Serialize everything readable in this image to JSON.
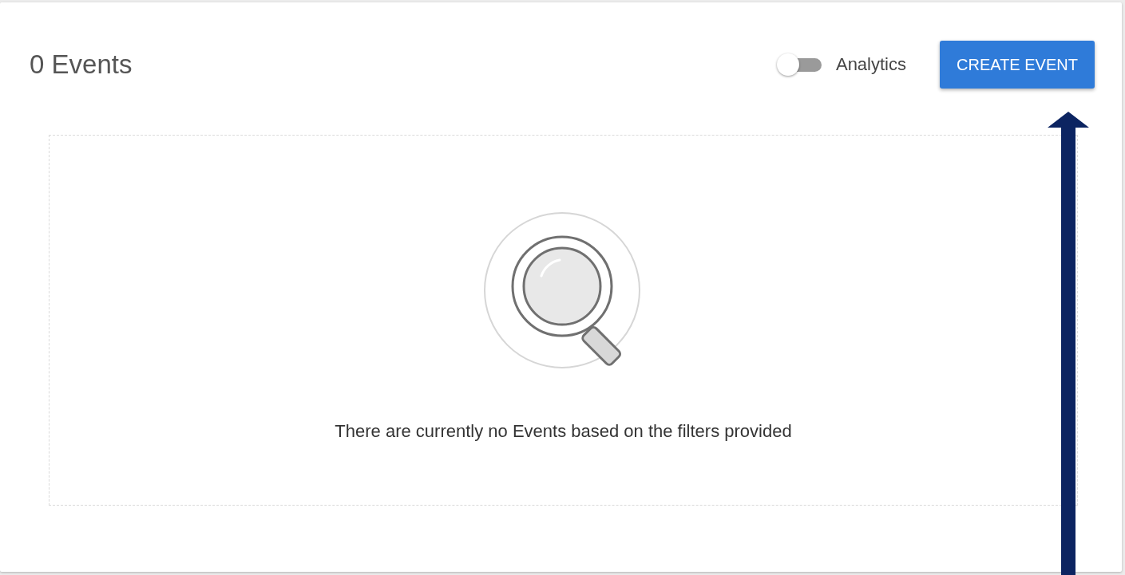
{
  "header": {
    "title": "0 Events",
    "analytics_toggle": {
      "label": "Analytics",
      "on": false
    },
    "create_button": "CREATE EVENT"
  },
  "empty_state": {
    "message": "There are currently no Events based on the filters provided"
  }
}
